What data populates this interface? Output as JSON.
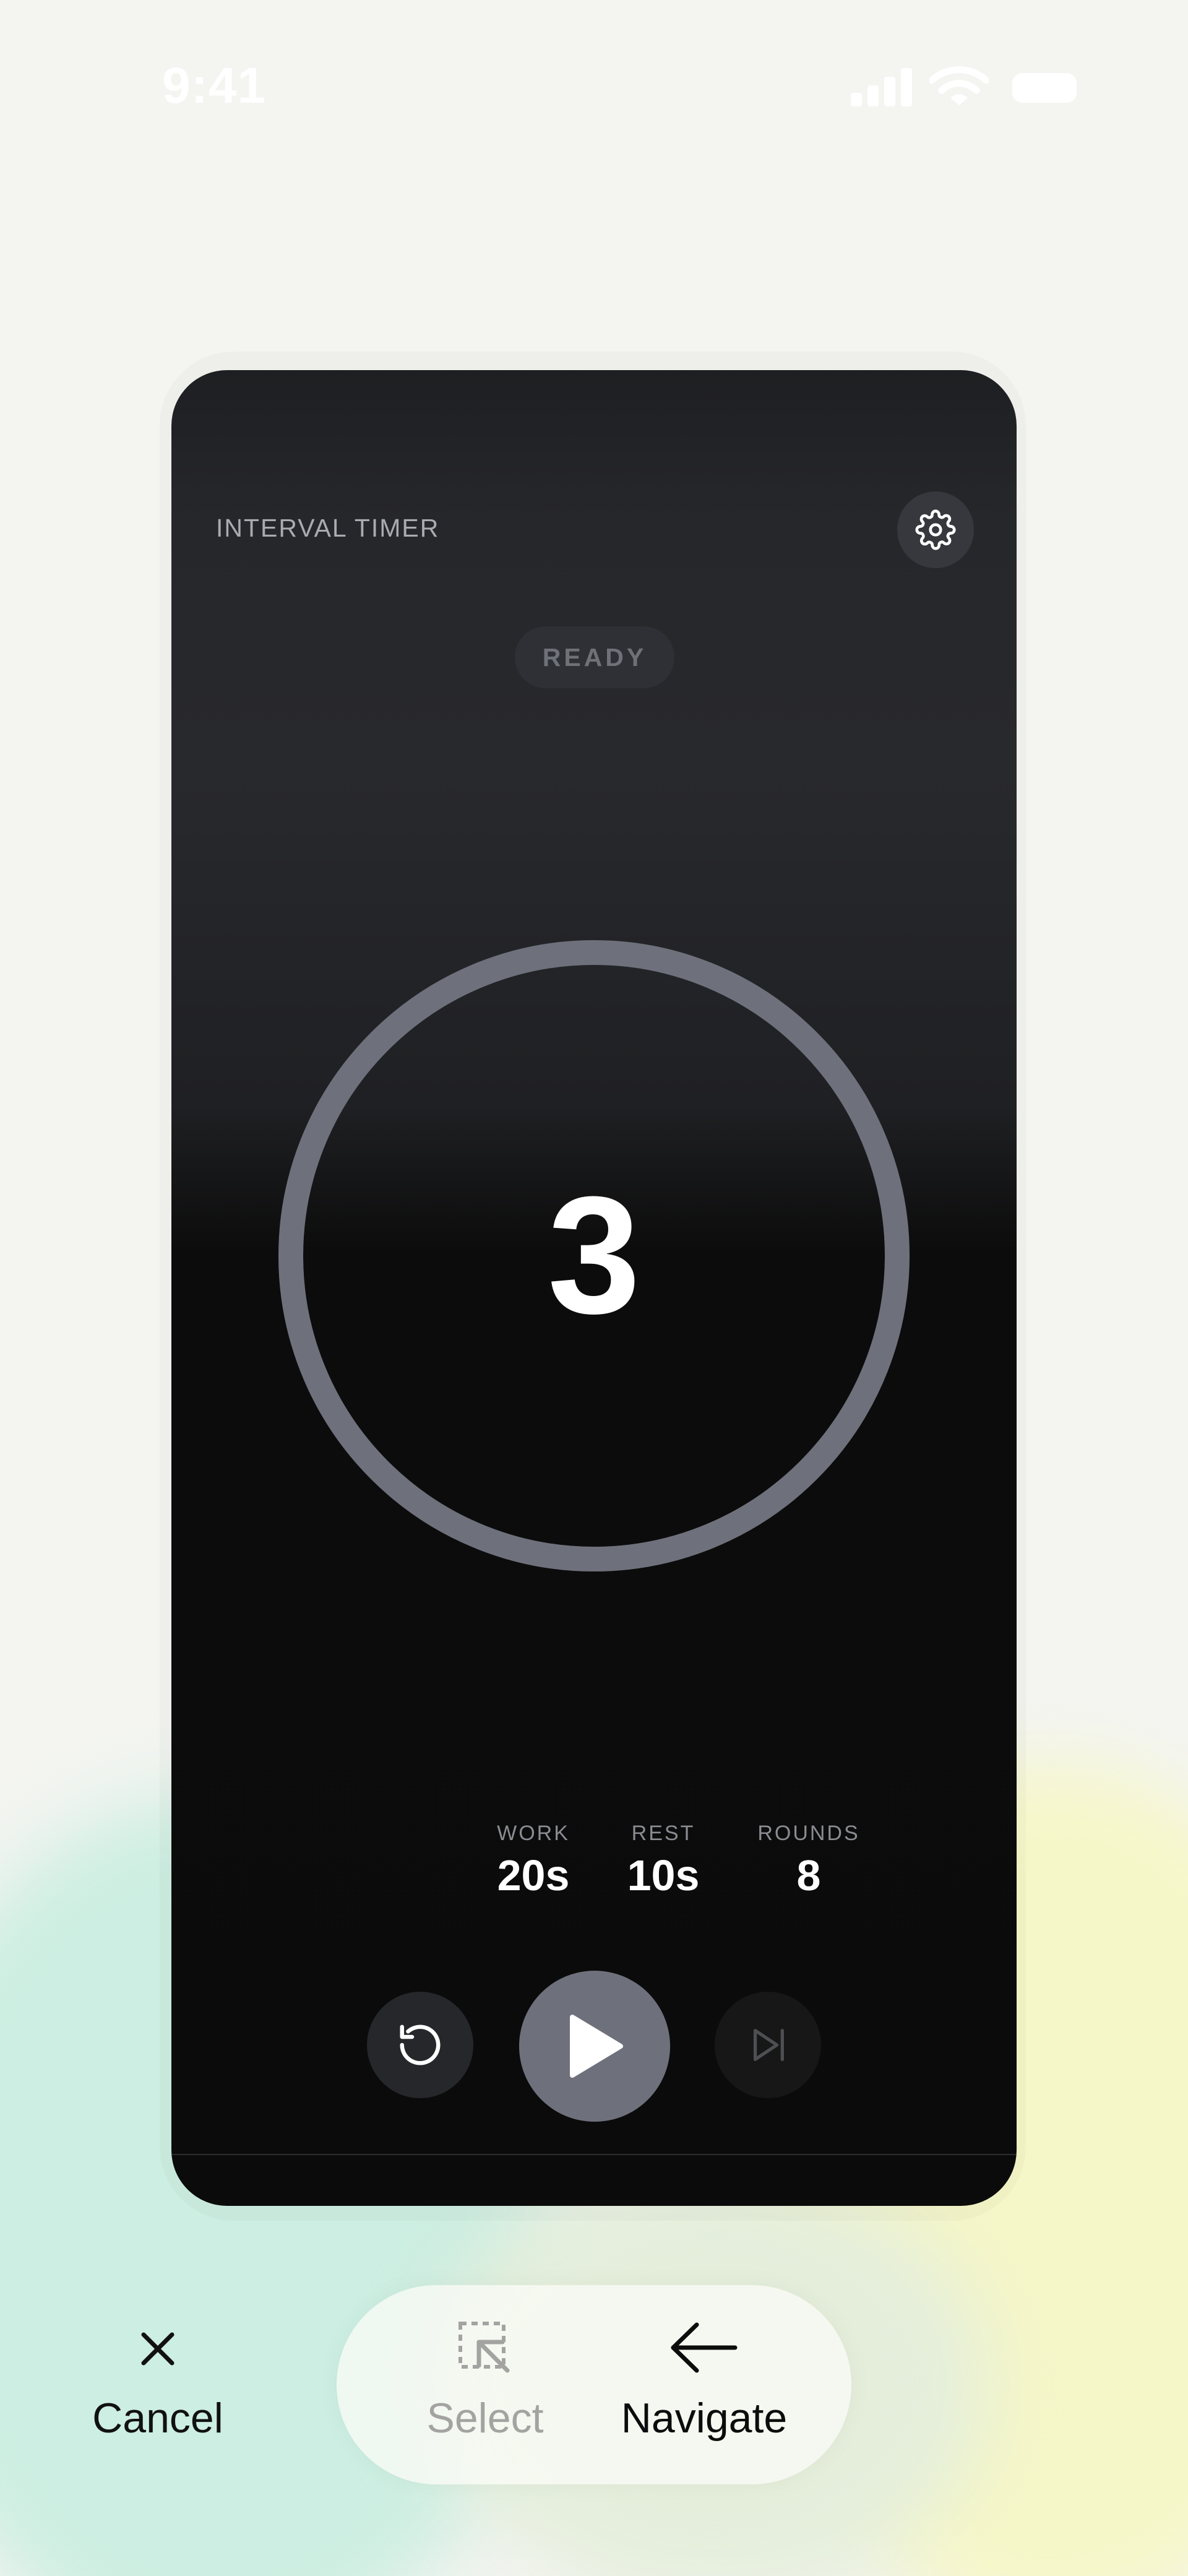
{
  "status_bar": {
    "time": "9:41"
  },
  "timer": {
    "app_title": "INTERVAL TIMER",
    "state_badge": "READY",
    "countdown": "3",
    "progress": 1.0,
    "stats": [
      {
        "label": "WORK",
        "value": "20s"
      },
      {
        "label": "REST",
        "value": "10s"
      },
      {
        "label": "ROUNDS",
        "value": "8"
      }
    ]
  },
  "toolbar": {
    "cancel_label": "Cancel",
    "select_label": "Select",
    "navigate_label": "Navigate"
  },
  "colors": {
    "ring": "#6e717c",
    "play_button": "#6e717c",
    "background": "#f4f5f1"
  },
  "icons": [
    "gear-icon",
    "reset-icon",
    "play-icon",
    "skip-icon",
    "close-icon",
    "select-icon",
    "arrow-left-icon"
  ]
}
